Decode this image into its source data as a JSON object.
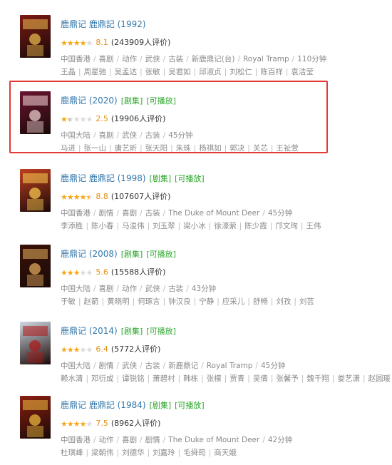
{
  "items": [
    {
      "title": "鹿鼎记 鹿鼎記 (1992)",
      "tags": [],
      "rating": 4,
      "score": "8.1",
      "votes": "(243909人评价)",
      "info": [
        "中国香港",
        "喜剧",
        "动作",
        "武侠",
        "古装",
        "新鹿鼎记(台)",
        "Royal Tramp",
        "110分钟"
      ],
      "cast": [
        "王晶",
        "周星驰",
        "吴孟达",
        "张敏",
        "吴君如",
        "邱淑贞",
        "刘松仁",
        "陈百祥",
        "袁洁莹"
      ]
    },
    {
      "title": "鹿鼎记 (2020)",
      "tags": [
        "[剧集]",
        "[可播放]"
      ],
      "rating": 1.5,
      "score": "2.5",
      "votes": "(19906人评价)",
      "info": [
        "中国大陆",
        "喜剧",
        "武侠",
        "古装",
        "45分钟"
      ],
      "cast": [
        "马进",
        "张一山",
        "唐艺昕",
        "张天阳",
        "朱珠",
        "杨祺如",
        "郭决",
        "关芯",
        "王祉萱"
      ]
    },
    {
      "title": "鹿鼎记 鹿鼎記 (1998)",
      "tags": [
        "[剧集]",
        "[可播放]"
      ],
      "rating": 4.5,
      "score": "8.8",
      "votes": "(107607人评价)",
      "info": [
        "中国香港",
        "剧情",
        "喜剧",
        "古装",
        "The Duke of Mount Deer",
        "45分钟"
      ],
      "cast": [
        "李添胜",
        "陈小春",
        "马浚伟",
        "刘玉翠",
        "梁小冰",
        "徐濠萦",
        "陈少霞",
        "邝文珣",
        "王伟"
      ]
    },
    {
      "title": "鹿鼎记 (2008)",
      "tags": [
        "[剧集]",
        "[可播放]"
      ],
      "rating": 3,
      "score": "5.6",
      "votes": "(15588人评价)",
      "info": [
        "中国大陆",
        "喜剧",
        "动作",
        "武侠",
        "古装",
        "43分钟"
      ],
      "cast": [
        "于敏",
        "赵箭",
        "黄晓明",
        "何琢言",
        "钟汉良",
        "宁静",
        "应采儿",
        "舒畅",
        "刘孜",
        "刘芸"
      ]
    },
    {
      "title": "鹿鼎记 (2014)",
      "tags": [
        "[剧集]",
        "[可播放]"
      ],
      "rating": 3,
      "score": "6.4",
      "votes": "(5772人评价)",
      "info": [
        "中国大陆",
        "剧情",
        "武侠",
        "古装",
        "新鹿鼎记",
        "Royal Tramp",
        "45分钟"
      ],
      "cast": [
        "赖水清",
        "邓衍成",
        "谭锐铭",
        "萧碧村",
        "韩栋",
        "张檬",
        "贾青",
        "吴倩",
        "张馨予",
        "魏千翔",
        "娄艺潇",
        "赵圆瑗"
      ]
    },
    {
      "title": "鹿鼎记 鹿鼎記 (1984)",
      "tags": [
        "[剧集]",
        "[可播放]"
      ],
      "rating": 4,
      "score": "7.5",
      "votes": "(8962人评价)",
      "info": [
        "中国香港",
        "动作",
        "喜剧",
        "剧情",
        "The Duke of Mount Deer",
        "42分钟"
      ],
      "cast": [
        "杜琪峰",
        "梁朝伟",
        "刘德华",
        "刘嘉玲",
        "毛舜筠",
        "商天娥"
      ]
    }
  ],
  "colors": {
    "accent": "#3377aa",
    "tag": "#2aa52a",
    "star": "#f7a715",
    "highlight": "#e53935"
  },
  "posters": [
    {
      "icon": "poster-1992",
      "bg": "#7a1a14",
      "fg": "#f0c050"
    },
    {
      "icon": "poster-2020",
      "bg": "#6a1430",
      "fg": "#f5d8d8"
    },
    {
      "icon": "poster-1998",
      "bg": "#c04020",
      "fg": "#ffd050"
    },
    {
      "icon": "poster-2008",
      "bg": "#3a1208",
      "fg": "#e8b060"
    },
    {
      "icon": "poster-2014",
      "bg": "#cfd8e0",
      "fg": "#b01818"
    },
    {
      "icon": "poster-1984",
      "bg": "#8a2010",
      "fg": "#f2c040"
    }
  ]
}
